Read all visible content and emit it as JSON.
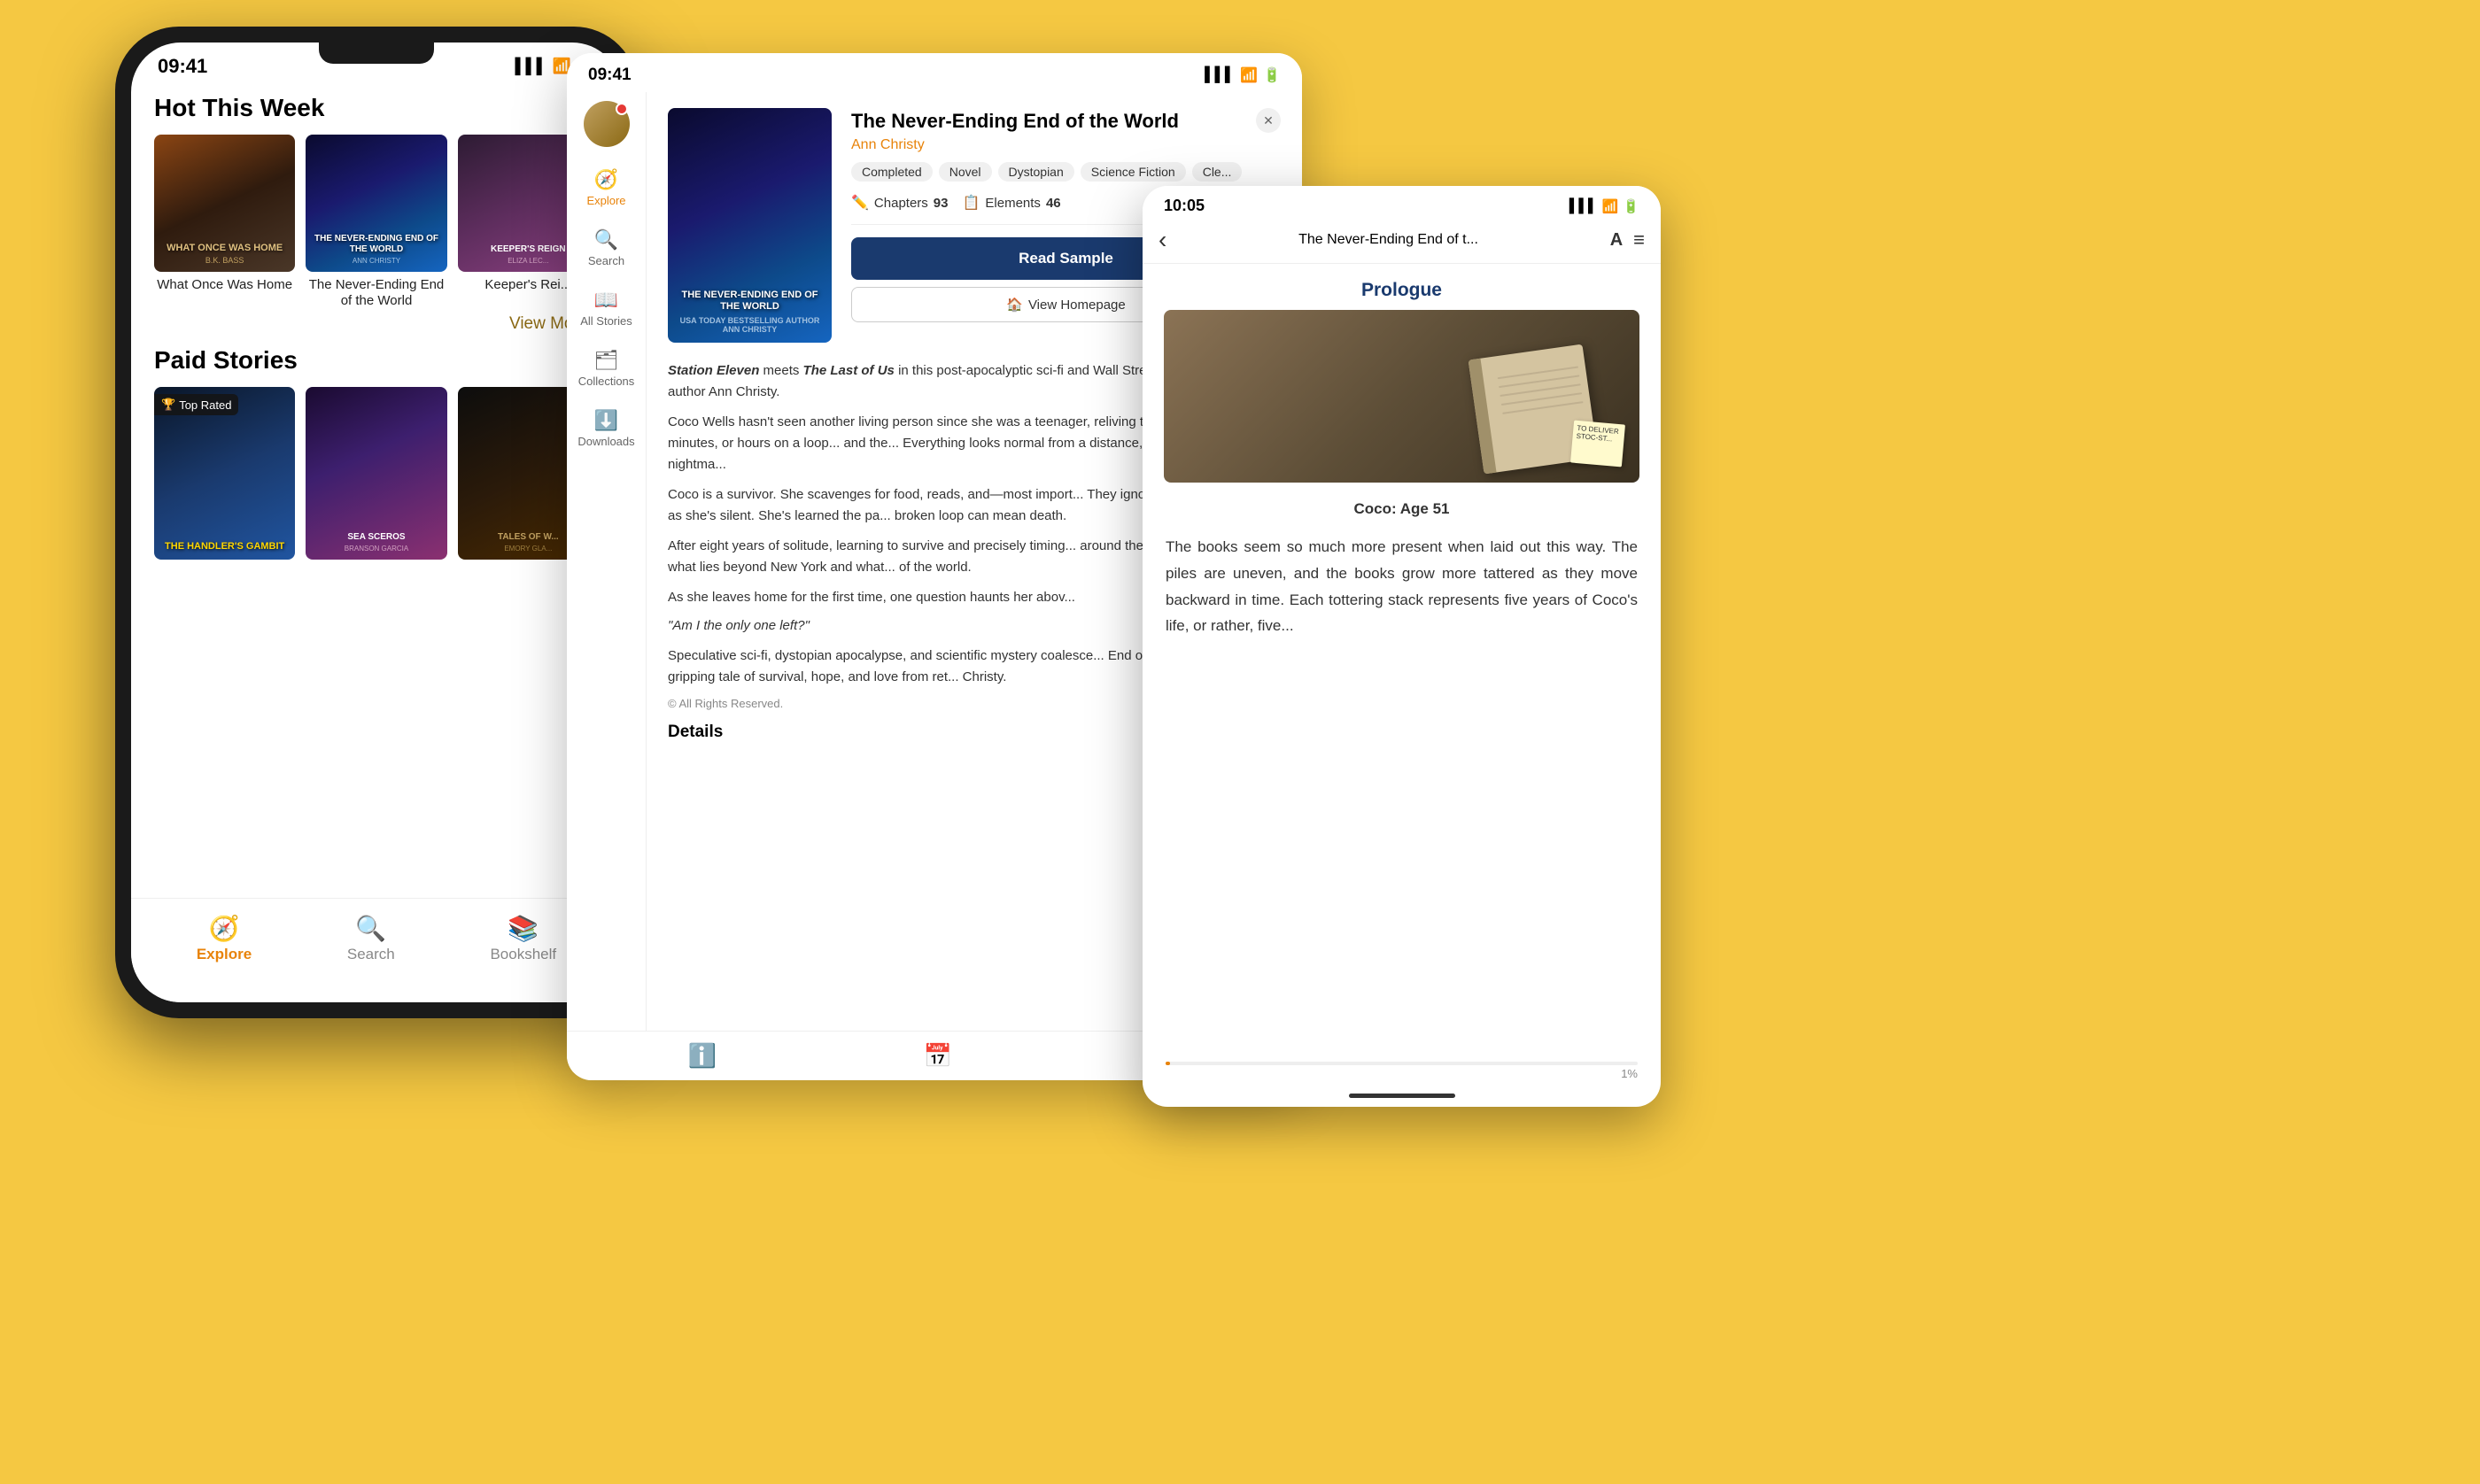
{
  "background": {
    "color": "#F5C842"
  },
  "phone1": {
    "status_bar": {
      "time": "09:41",
      "signal": "▌▌▌",
      "wifi": "WiFi",
      "battery": "🔋"
    },
    "hot_section": {
      "title": "Hot This Week",
      "books": [
        {
          "title": "What Once Was Home",
          "author": "B.K. Bass",
          "cover_style": "what-once"
        },
        {
          "title": "The Never-Ending End of the World",
          "author": "Ann Christy",
          "cover_style": "never-ending"
        },
        {
          "title": "Keeper's Reign",
          "author": "Eliza Lec...",
          "cover_style": "keeper"
        }
      ],
      "view_more": "View More ›"
    },
    "paid_section": {
      "title": "Paid Stories",
      "badge": "Top Rated",
      "books": [
        {
          "title": "The Handler's Gambit",
          "cover_style": "handler"
        },
        {
          "title": "Sea Sceros",
          "author": "Branson Garcia",
          "cover_style": "sea"
        },
        {
          "title": "Tales of W...",
          "author": "Emory Gla...",
          "cover_style": "tales"
        }
      ]
    },
    "bottom_nav": {
      "items": [
        {
          "label": "Explore",
          "active": true,
          "icon": "🧭"
        },
        {
          "label": "Search",
          "active": false,
          "icon": "🔍"
        },
        {
          "label": "Bookshelf",
          "active": false,
          "icon": "📚"
        }
      ]
    }
  },
  "tablet": {
    "status_bar": {
      "time": "09:41",
      "signal": "▌▌▌",
      "wifi": "WiFi",
      "battery": "🔋"
    },
    "sidebar": {
      "items": [
        {
          "label": "Explore",
          "icon": "🧭",
          "active": true
        },
        {
          "label": "Search",
          "icon": "🔍",
          "active": false
        },
        {
          "label": "All Stories",
          "icon": "📖",
          "active": false
        },
        {
          "label": "Collections",
          "icon": "🗂",
          "active": false
        },
        {
          "label": "Downloads",
          "icon": "⬇",
          "active": false
        }
      ]
    },
    "book": {
      "title": "The Never-Ending End of the World",
      "author": "Ann Christy",
      "tags": [
        "Completed",
        "Novel",
        "Dystopian",
        "Science Fiction",
        "Cle..."
      ],
      "stats": {
        "chapters_label": "Chapters",
        "chapters_value": "93",
        "elements_label": "Elements",
        "elements_value": "46"
      },
      "buttons": {
        "read_sample": "Read Sample",
        "view_homepage": "View Homepage"
      },
      "description_1": "Station Eleven meets The Last of Us in this post-apocalyptic sci-fi and Wall Street Journal best-selling author Ann Christy.",
      "description_2": "Coco Wells hasn't seen another living person since she was a teenager, reliving the same few seconds, minutes, or hours on a loop... and the... Everything looks normal from a distance, but up close it's a nightma...",
      "description_3": "Coco is a survivor. She scavenges for food, reads, and—most import... They ignore her, but only as long as she's silent. She's learned the pa... broken loop can mean death.",
      "description_4": "After eight years of solitude, learning to survive and precisely timing... around the city, Coco wonders what lies beyond New York and what... of the world.",
      "description_5": "As she leaves home for the first time, one question haunts her abov...",
      "quote": "\"Am I the only one left?\"",
      "description_6": "Speculative sci-fi, dystopian apocalypse, and scientific mystery coalesce... End of the World — a gripping tale of survival, hope, and love from ret... Christy.",
      "copyright": "© All Rights Reserved.",
      "details_heading": "Details"
    }
  },
  "reader": {
    "status_bar": {
      "time": "10:05",
      "signal": "▌▌▌",
      "wifi": "WiFi",
      "battery": "🔋"
    },
    "nav": {
      "back_icon": "‹",
      "title": "The Never-Ending End of t...",
      "font_icon": "A",
      "toc_icon": "≡"
    },
    "chapter": {
      "heading": "Prologue",
      "subtitle": "Coco: Age 51"
    },
    "text": "The books seem so much more present when laid out this way. The piles are uneven, and the books grow more tattered as they move backward in time. Each tottering stack represents five years of Coco's life, or rather, five...",
    "progress": {
      "percent": 1,
      "label": "1%"
    }
  }
}
